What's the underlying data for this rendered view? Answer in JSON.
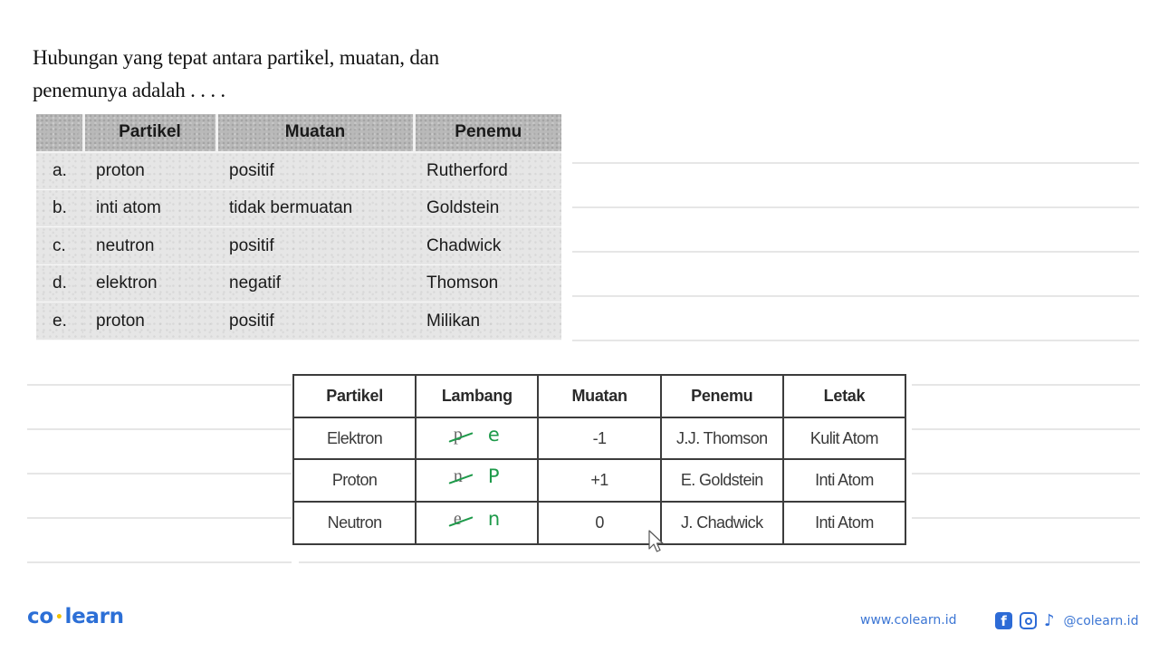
{
  "question": {
    "line1": "Hubungan yang tepat antara partikel, muatan, dan",
    "line2": "penemunya adalah . . . ."
  },
  "options_table": {
    "headers": [
      "",
      "Partikel",
      "Muatan",
      "Penemu"
    ],
    "rows": [
      {
        "label": "a.",
        "partikel": "proton",
        "muatan": "positif",
        "penemu": "Rutherford"
      },
      {
        "label": "b.",
        "partikel": "inti atom",
        "muatan": "tidak bermuatan",
        "penemu": "Goldstein"
      },
      {
        "label": "c.",
        "partikel": "neutron",
        "muatan": "positif",
        "penemu": "Chadwick"
      },
      {
        "label": "d.",
        "partikel": "elektron",
        "muatan": "negatif",
        "penemu": "Thomson"
      },
      {
        "label": "e.",
        "partikel": "proton",
        "muatan": "positif",
        "penemu": "Milikan"
      }
    ]
  },
  "answer_table": {
    "headers": [
      "Partikel",
      "Lambang",
      "Muatan",
      "Penemu",
      "Letak"
    ],
    "rows": [
      {
        "partikel": "Elektron",
        "lambang_old": "p",
        "lambang_new": "e",
        "muatan": "-1",
        "penemu": "J.J. Thomson",
        "letak": "Kulit Atom"
      },
      {
        "partikel": "Proton",
        "lambang_old": "n",
        "lambang_new": "P",
        "muatan": "+1",
        "penemu": "E. Goldstein",
        "letak": "Inti Atom"
      },
      {
        "partikel": "Neutron",
        "lambang_old": "e",
        "lambang_new": "n",
        "muatan": "0",
        "penemu": "J. Chadwick",
        "letak": "Inti Atom"
      }
    ],
    "annotation_color": "#1e9a4a"
  },
  "footer": {
    "brand_left": "co",
    "brand_dot": "•",
    "brand_right": "learn",
    "website": "www.colearn.id",
    "social_icons": [
      "facebook-icon",
      "instagram-icon",
      "tiktok-icon"
    ],
    "facebook_glyph": "f",
    "tiktok_glyph": "♪",
    "handle": "@colearn.id",
    "brand_color": "#2c6fd6"
  }
}
